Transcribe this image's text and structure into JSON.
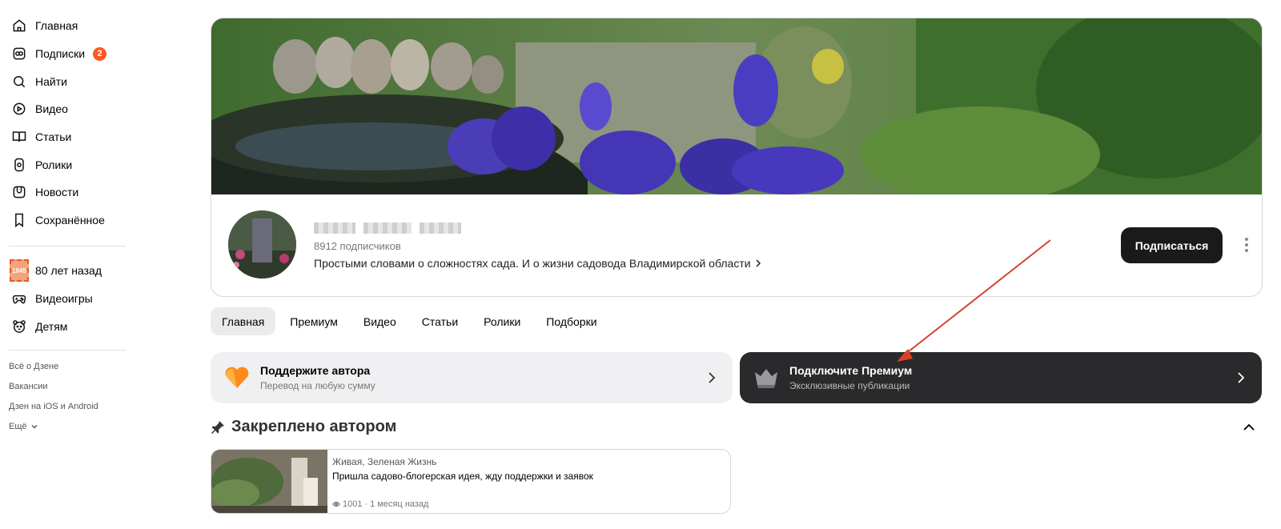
{
  "sidebar": {
    "items": [
      {
        "label": "Главная",
        "icon": "home-icon"
      },
      {
        "label": "Подписки",
        "icon": "subscriptions-icon",
        "badge": "2"
      },
      {
        "label": "Найти",
        "icon": "search-icon"
      },
      {
        "label": "Видео",
        "icon": "video-icon"
      },
      {
        "label": "Статьи",
        "icon": "articles-icon"
      },
      {
        "label": "Ролики",
        "icon": "shorts-icon"
      },
      {
        "label": "Новости",
        "icon": "news-icon"
      },
      {
        "label": "Сохранённое",
        "icon": "bookmark-icon"
      }
    ],
    "special_items": [
      {
        "label": "80 лет назад",
        "icon": "stamp-1945-icon",
        "stamp_text": "1945"
      },
      {
        "label": "Видеоигры",
        "icon": "gamepad-icon"
      },
      {
        "label": "Детям",
        "icon": "bear-icon"
      }
    ],
    "footer": {
      "about": "Всё о Дзене",
      "jobs": "Вакансии",
      "apps": "Дзен на iOS и Android",
      "more": "Ещё"
    }
  },
  "channel": {
    "subscribers": "8912 подписчиков",
    "description": "Простыми словами о сложностях сада. И о жизни садовода Владимирской области",
    "subscribe_label": "Подписаться"
  },
  "tabs": [
    "Главная",
    "Премиум",
    "Видео",
    "Статьи",
    "Ролики",
    "Подборки"
  ],
  "promo": {
    "support": {
      "title": "Поддержите автора",
      "subtitle": "Перевод на любую сумму"
    },
    "premium": {
      "title": "Подключите Премиум",
      "subtitle": "Эксклюзивные публикации"
    }
  },
  "pinned": {
    "title": "Закреплено автором",
    "post": {
      "author": "Живая, Зеленая Жизнь",
      "title": "Пришла садово-блогерская идея, жду поддержки и заявок",
      "views": "1001",
      "age": "1 месяц назад"
    }
  },
  "colors": {
    "accent_badge": "#ff5722",
    "subscribe_bg": "#1a1a1a",
    "premium_bg": "#2a2a2c",
    "annotation_arrow": "#d9412c"
  }
}
